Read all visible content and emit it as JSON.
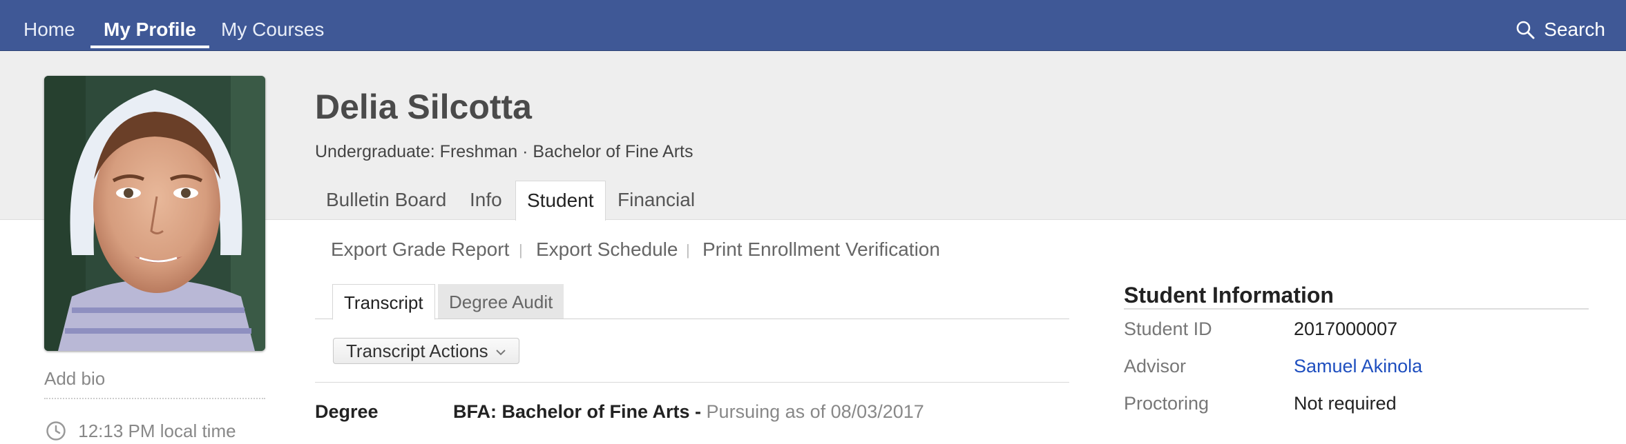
{
  "nav": {
    "items": [
      {
        "label": "Home"
      },
      {
        "label": "My Profile"
      },
      {
        "label": "My Courses"
      }
    ],
    "search_label": "Search"
  },
  "profile": {
    "name": "Delia Silcotta",
    "subtitle": "Undergraduate: Freshman · Bachelor of Fine Arts",
    "add_bio": "Add bio",
    "local_time": "12:13 PM local time"
  },
  "tabs": [
    {
      "label": "Bulletin Board"
    },
    {
      "label": "Info"
    },
    {
      "label": "Student"
    },
    {
      "label": "Financial"
    }
  ],
  "actions": {
    "export_grade_report": "Export Grade Report",
    "export_schedule": "Export Schedule",
    "print_enrollment": "Print Enrollment Verification",
    "separator": "|"
  },
  "sub_tabs": [
    {
      "label": "Transcript"
    },
    {
      "label": "Degree Audit"
    }
  ],
  "transcript_actions_label": "Transcript Actions",
  "degree": {
    "label": "Degree",
    "value": "BFA: Bachelor of Fine Arts",
    "separator": " - ",
    "status": "Pursuing as of 08/03/2017"
  },
  "student_info": {
    "title": "Student Information",
    "rows": [
      {
        "label": "Student ID",
        "value": "2017000007"
      },
      {
        "label": "Advisor",
        "value": "Samuel Akinola"
      },
      {
        "label": "Proctoring",
        "value": "Not required"
      }
    ]
  },
  "colors": {
    "nav_bg": "#3f5896",
    "header_bg": "#eeeeee",
    "link": "#1f4fbf"
  },
  "icons": {
    "search": "search-icon",
    "clock": "clock-icon",
    "dropdown": "chevron-down-icon"
  }
}
